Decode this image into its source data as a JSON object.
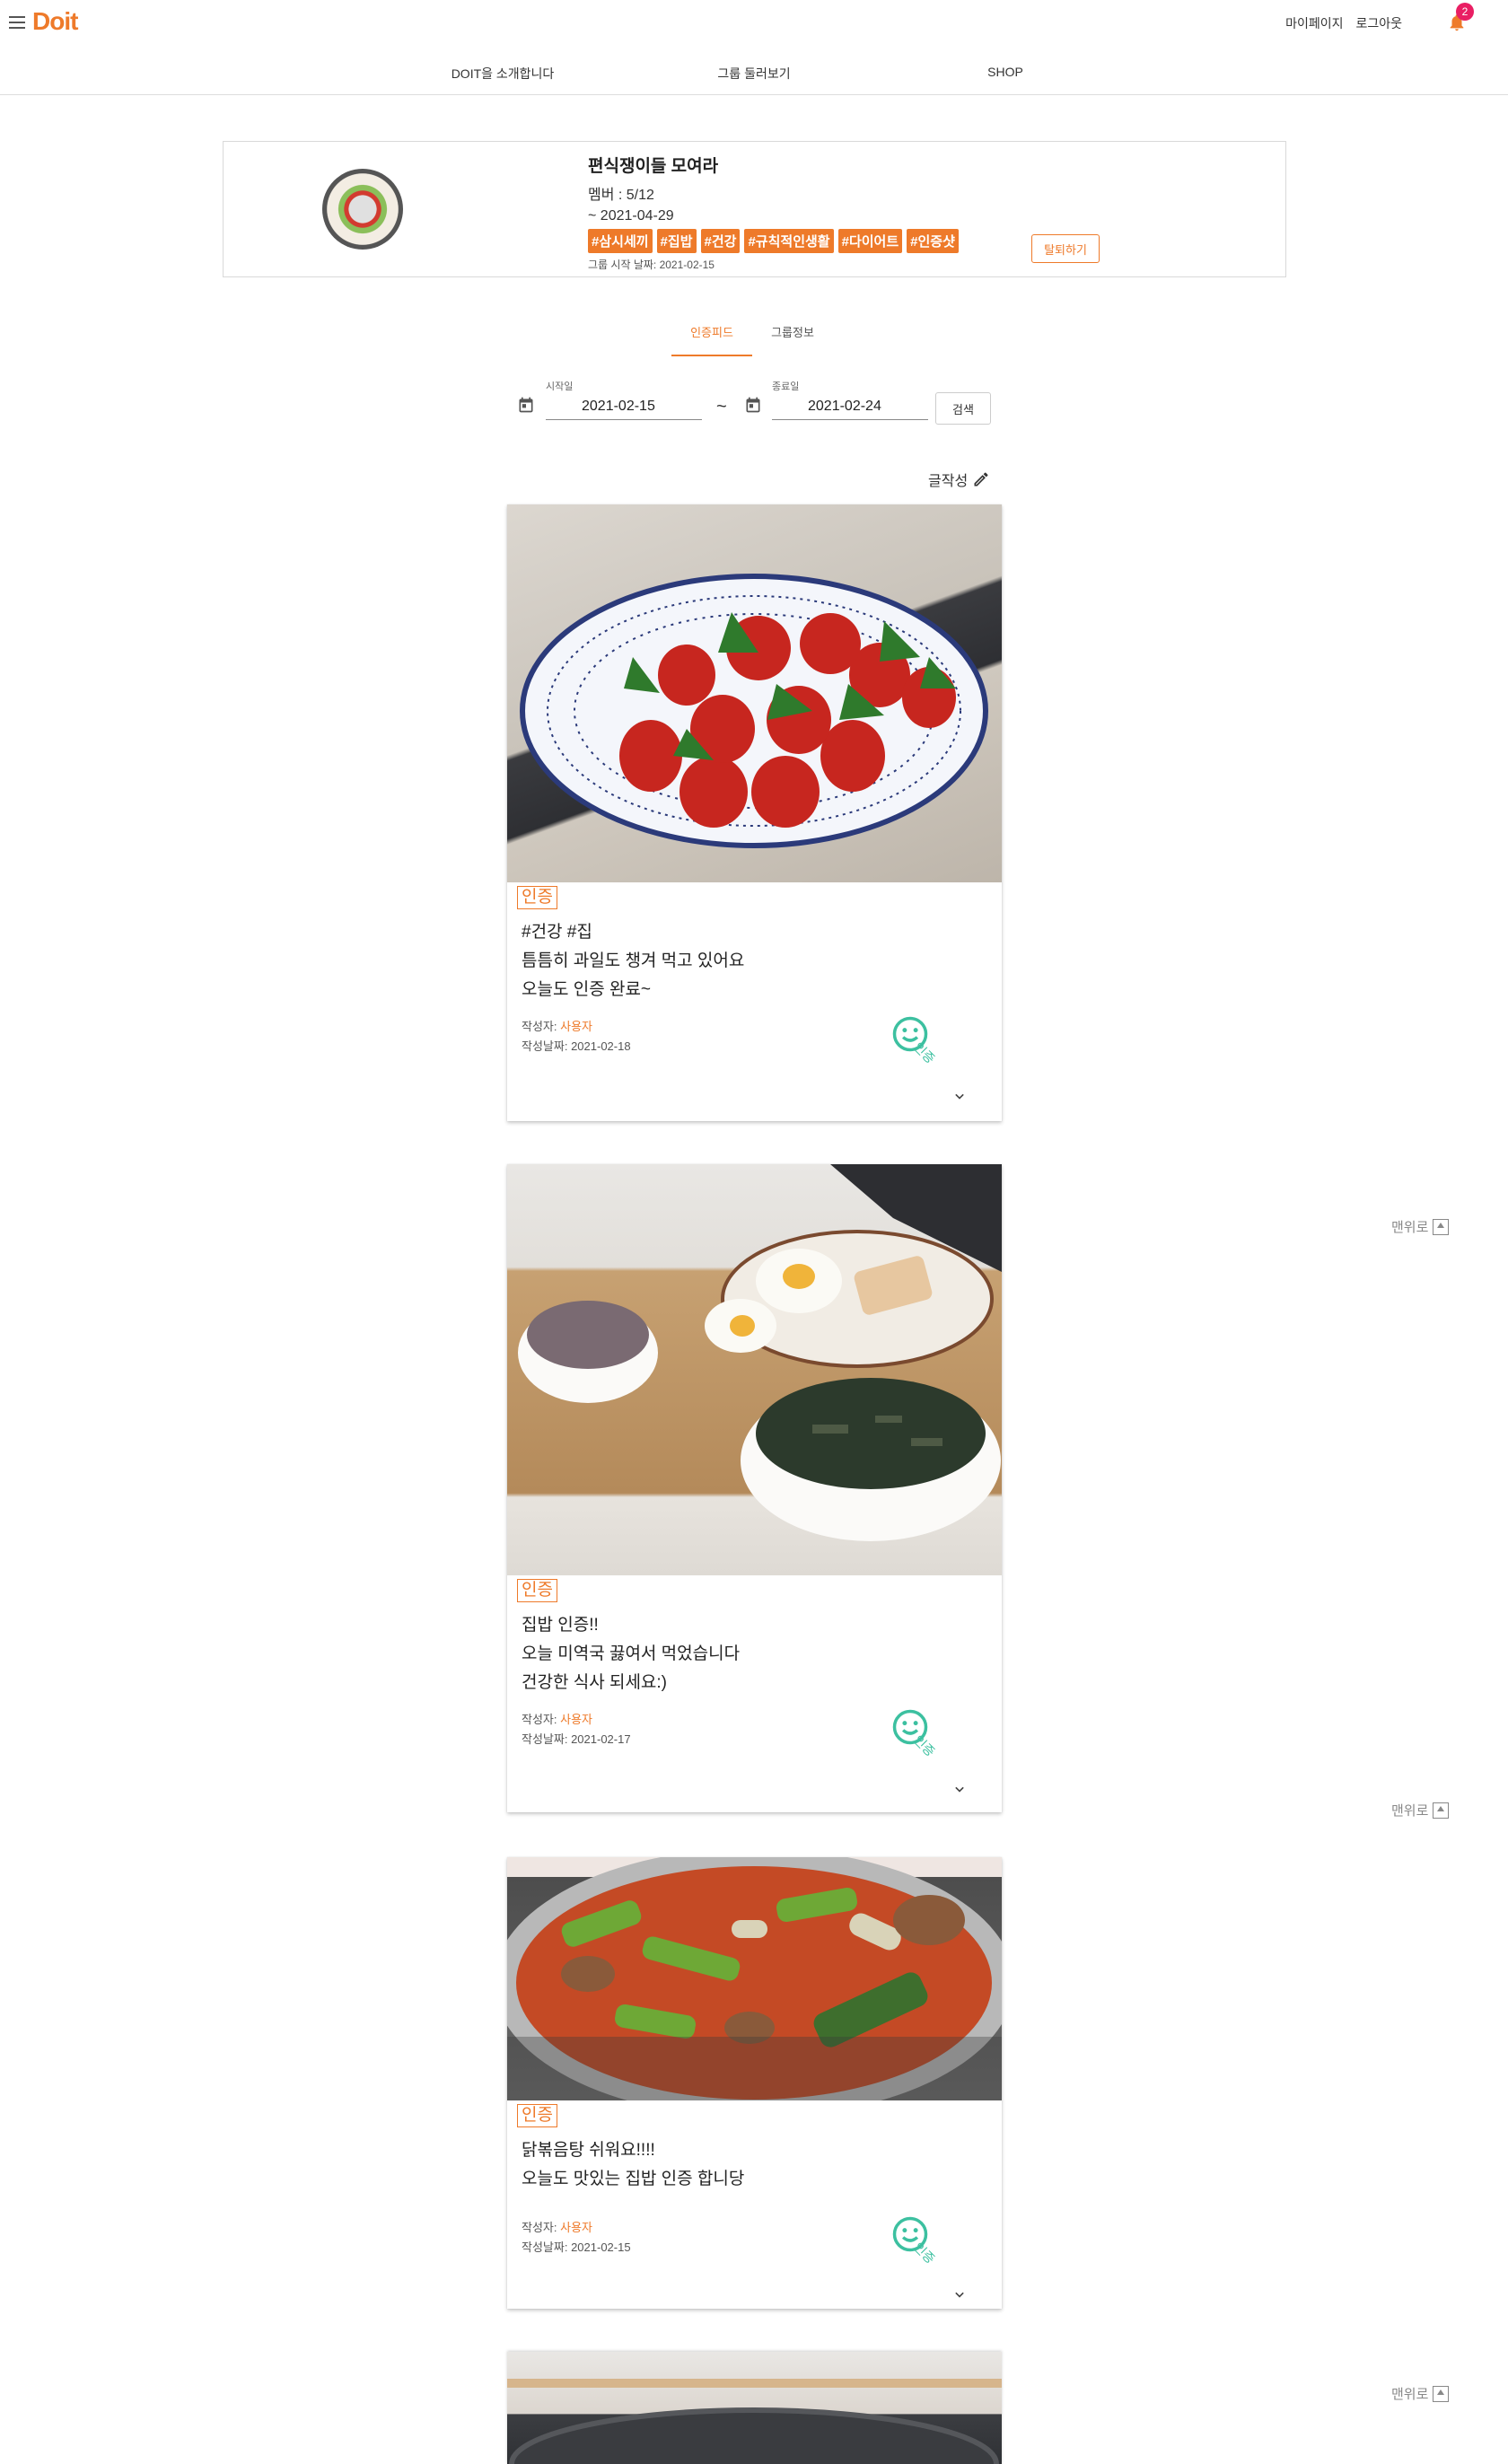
{
  "header": {
    "logo": "Doit",
    "mypage": "마이페이지",
    "logout": "로그아웃",
    "notification_count": "2"
  },
  "nav": {
    "items": [
      "DOIT을 소개합니다",
      "그룹 둘러보기",
      "SHOP"
    ]
  },
  "group": {
    "name": "편식쟁이들 모여라",
    "members": "멤버 : 5/12",
    "period": "~ 2021-04-29",
    "tags": [
      "#삼시세끼",
      "#집밥",
      "#건강",
      "#규칙적인생활",
      "#다이어트",
      "#인증샷"
    ],
    "start_date": "그룹 시작 날짜: 2021-02-15",
    "leave_button": "탈퇴하기"
  },
  "tabs": [
    "인증피드",
    "그룹정보"
  ],
  "search": {
    "start_label": "시작일",
    "start_value": "2021-02-15",
    "end_label": "종료일",
    "end_value": "2021-02-24",
    "separator": "~",
    "button": "검색"
  },
  "write_button": "글작성",
  "posts": [
    {
      "chip": "인증",
      "lines": [
        "#건강 #집",
        "틈틈히 과일도 챙겨 먹고 있어요",
        "오늘도 인증 완료~"
      ],
      "author_label": "작성자: ",
      "author": "사용자",
      "date": "작성날짜: 2021-02-18",
      "cert_label": "인증"
    },
    {
      "chip": "인증",
      "lines": [
        "집밥 인증!!",
        "오늘 미역국 끓여서 먹었습니다",
        "건강한 식사 되세요:)"
      ],
      "author_label": "작성자: ",
      "author": "사용자",
      "date": "작성날짜: 2021-02-17",
      "cert_label": "인증"
    },
    {
      "chip": "인증",
      "lines": [
        "닭볶음탕 쉬워요!!!!",
        "오늘도 맛있는 집밥 인증 합니당"
      ],
      "author_label": "작성자: ",
      "author": "사용자",
      "date": "작성날짜: 2021-02-15",
      "cert_label": "인증"
    }
  ],
  "top_link": "맨위로",
  "colors": {
    "brand": "#ee7a2a",
    "cert": "#3cc0a0",
    "badge": "#e91e63"
  }
}
